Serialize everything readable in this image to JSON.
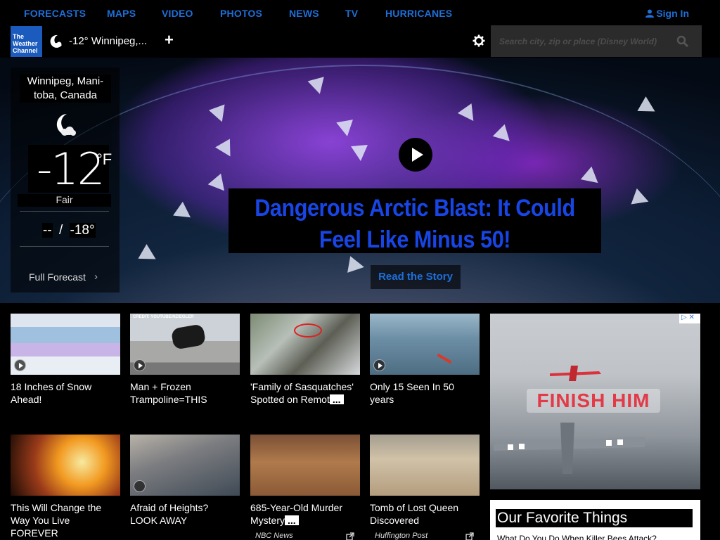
{
  "nav": {
    "links": [
      "FORECASTS",
      "MAPS",
      "VIDEO",
      "PHOTOS",
      "NEWS",
      "TV",
      "HURRICANES"
    ],
    "signin_label": "Sign In"
  },
  "brandbar": {
    "logo_lines": [
      "The",
      "Weather",
      "Channel"
    ],
    "location_temp": "-12° Winnipeg,...",
    "add_label": "+",
    "search_placeholder": "Search city, zip or place (Disney World)"
  },
  "current": {
    "location": "Winnipeg, Mani-toba, Canada",
    "temp": "-12",
    "unit": "°F",
    "condition": "Fair",
    "high": "--",
    "separator": "/",
    "low": "-18°",
    "full_forecast_label": "Full Forecast",
    "chevron": "›"
  },
  "hero": {
    "headline_line1": "Dangerous Arctic Blast: It Could",
    "headline_line2": "Feel Like Minus 50!",
    "cta": "Read the Story"
  },
  "tiles": [
    {
      "title": "18 Inches of Snow Ahead!",
      "media": "video"
    },
    {
      "title": "Man + Frozen Trampoline=THIS",
      "media": "video",
      "caption": "CREDIT: YOUTUBE/NZIEGLER"
    },
    {
      "title": "'Family of Sasquatches' Spotted on Remot",
      "ellipsis": "...",
      "media": "none"
    },
    {
      "title": "Only 15 Seen In 50 years",
      "media": "video"
    },
    {
      "title": "This Will Change the Way You Live FOREVER",
      "media": "none"
    },
    {
      "title": "Afraid of Heights? LOOK AWAY",
      "media": "photo"
    },
    {
      "title": "685-Year-Old Murder Mystery",
      "ellipsis": "...",
      "media": "none",
      "source": "NBC News"
    },
    {
      "title": "Tomb of Lost Queen Discovered",
      "media": "none",
      "source": "Huffington Post"
    }
  ],
  "ad": {
    "text": "FINISH HIM",
    "badge": "▷ ✕"
  },
  "favorites": {
    "title": "Our Favorite Things",
    "first_item": "What Do You Do When Killer Bees Attack?"
  }
}
